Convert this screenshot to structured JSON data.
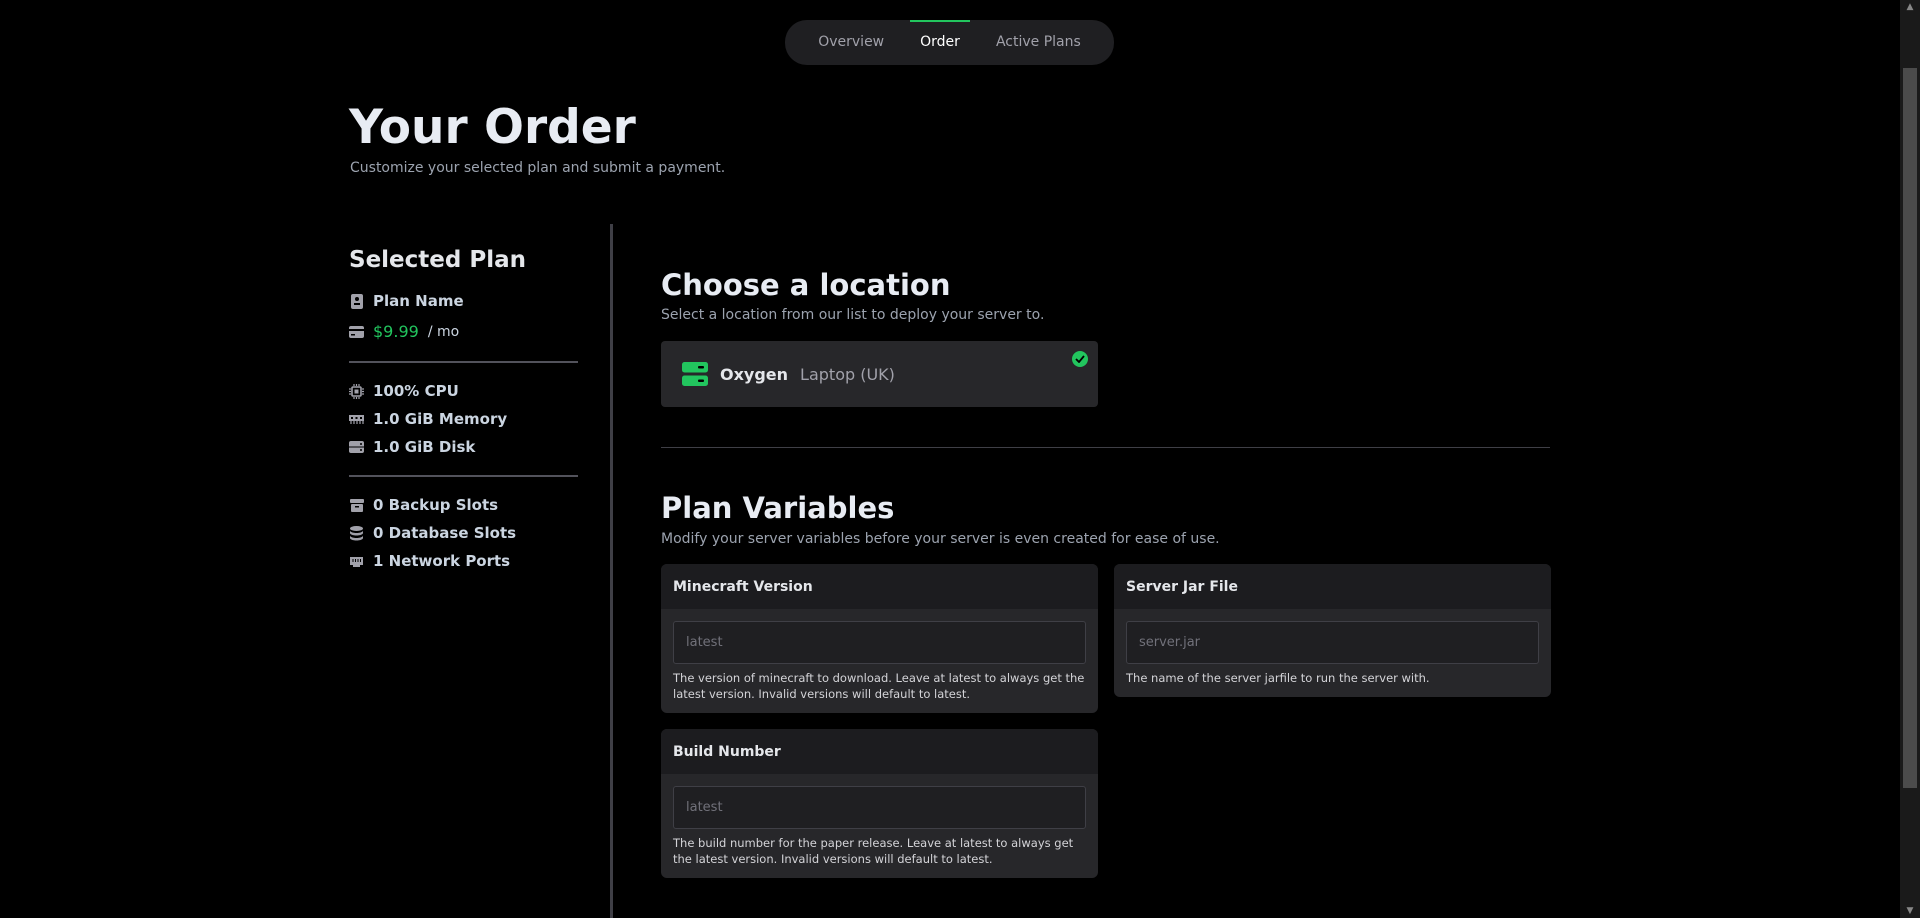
{
  "nav": {
    "tabs": [
      {
        "label": "Overview"
      },
      {
        "label": "Order"
      },
      {
        "label": "Active Plans"
      }
    ],
    "active": "Order"
  },
  "header": {
    "title": "Your Order",
    "subtitle": "Customize your selected plan and submit a payment."
  },
  "sidebar": {
    "title": "Selected Plan",
    "plan_name": "Plan Name",
    "price": "$9.99",
    "per": "/ mo",
    "specs": [
      "100% CPU",
      "1.0 GiB Memory",
      "1.0 GiB Disk"
    ],
    "limits": [
      "0 Backup Slots",
      "0 Database Slots",
      "1 Network Ports"
    ]
  },
  "location": {
    "title": "Choose a location",
    "description": "Select a location from our list to deploy your server to.",
    "selected_name": "Oxygen",
    "selected_sub": "Laptop (UK)"
  },
  "variables": {
    "title": "Plan Variables",
    "description": "Modify your server variables before your server is even created for ease of use.",
    "fields": [
      {
        "label": "Minecraft Version",
        "placeholder": "latest",
        "help": "The version of minecraft to download.   Leave at latest to always get the latest version. Invalid versions will default to latest."
      },
      {
        "label": "Server Jar File",
        "placeholder": "server.jar",
        "help": "The name of the server jarfile to run the server with."
      },
      {
        "label": "Build Number",
        "placeholder": "latest",
        "help": "The build number for the paper release.  Leave at latest to always get the latest version. Invalid versions will default to latest."
      }
    ]
  },
  "colors": {
    "accent": "#22c55e",
    "background": "#000000",
    "card": "#27272a"
  }
}
